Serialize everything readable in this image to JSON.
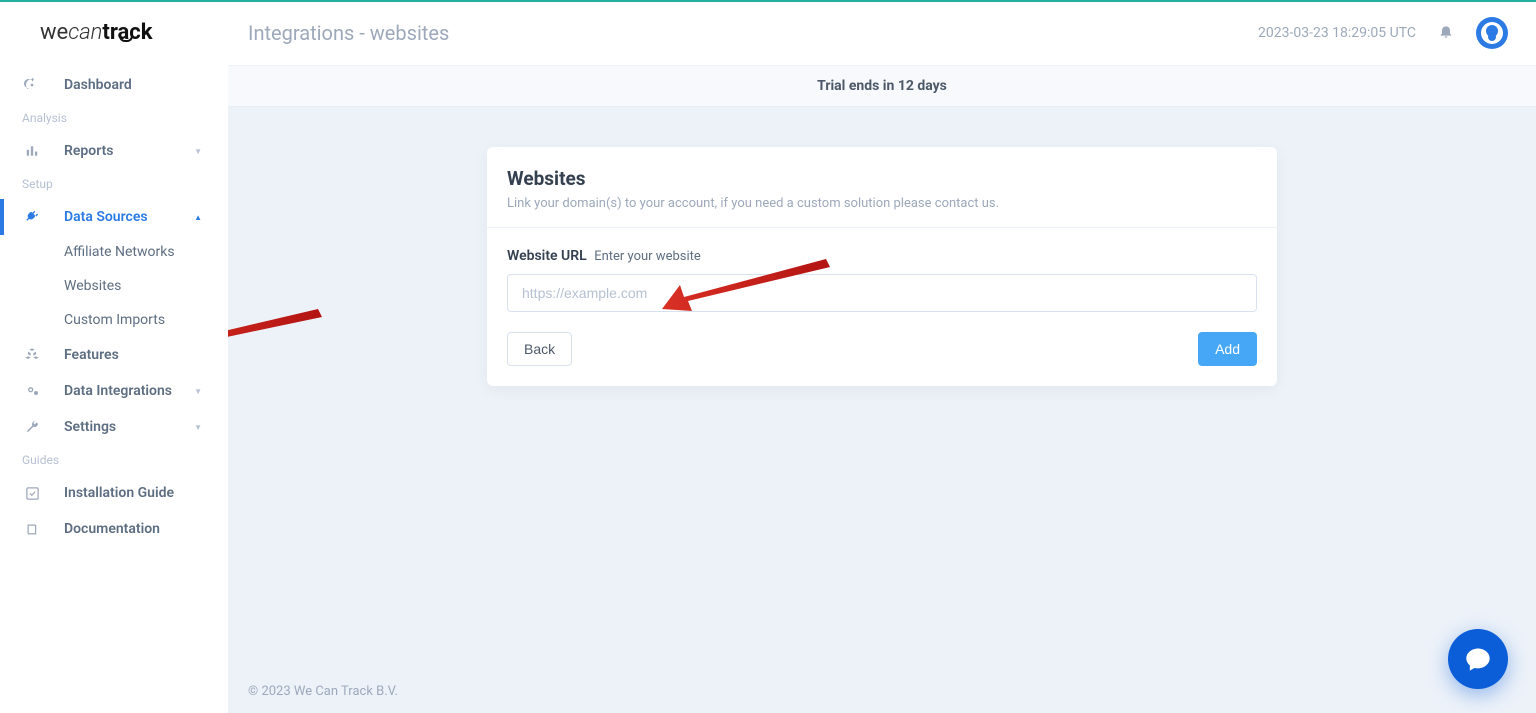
{
  "logo": {
    "p1": "we",
    "p2": "can",
    "p3": "track"
  },
  "sidebar": {
    "dashboard": "Dashboard",
    "section_analysis": "Analysis",
    "reports": "Reports",
    "section_setup": "Setup",
    "data_sources": "Data Sources",
    "sub_affiliate": "Affiliate Networks",
    "sub_websites": "Websites",
    "sub_custom": "Custom Imports",
    "features": "Features",
    "data_integrations": "Data Integrations",
    "settings": "Settings",
    "section_guides": "Guides",
    "install_guide": "Installation Guide",
    "documentation": "Documentation"
  },
  "header": {
    "title": "Integrations - websites",
    "timestamp": "2023-03-23 18:29:05 UTC"
  },
  "banner": {
    "text": "Trial ends in 12 days"
  },
  "card": {
    "title": "Websites",
    "subtitle": "Link your domain(s) to your account, if you need a custom solution please contact us.",
    "label": "Website URL",
    "label_hint": "Enter your website",
    "placeholder": "https://example.com",
    "back": "Back",
    "add": "Add"
  },
  "footer": {
    "copyright": "© 2023 We Can Track B.V."
  }
}
